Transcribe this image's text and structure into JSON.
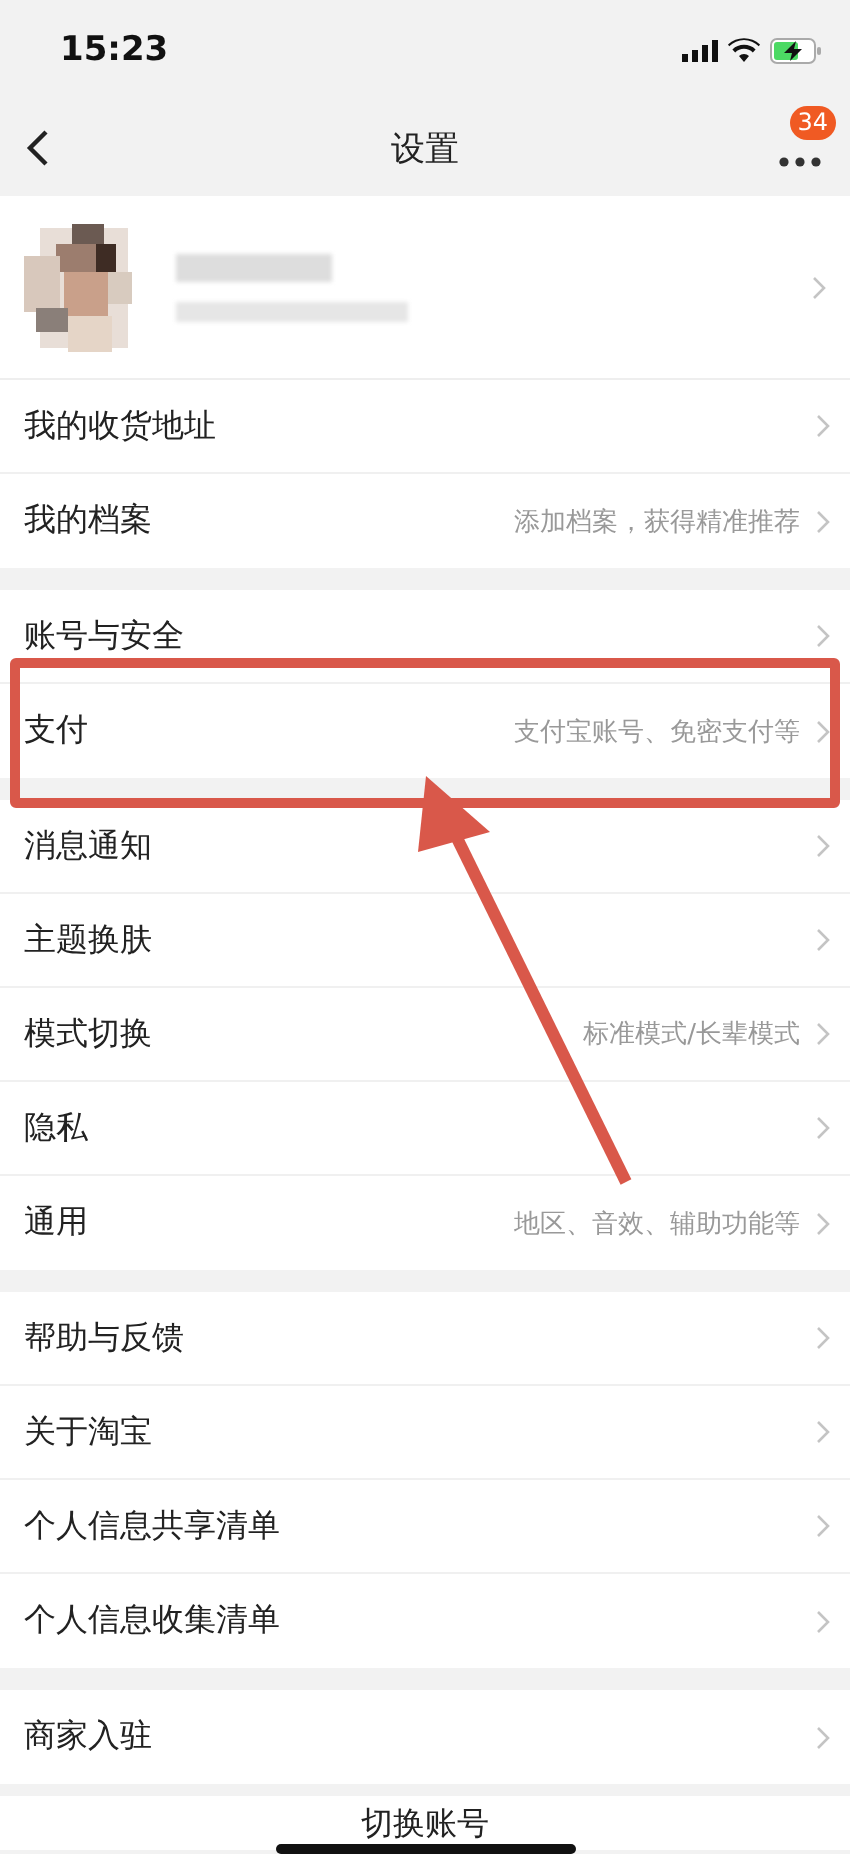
{
  "status_bar": {
    "time": "15:23"
  },
  "nav": {
    "title": "设置",
    "badge": "34"
  },
  "groups": [
    {
      "profile": true,
      "items": [
        {
          "label": "我的收货地址",
          "highlighted": false
        },
        {
          "label": "我的档案",
          "hint": "添加档案，获得精准推荐",
          "highlighted": false
        }
      ]
    },
    {
      "items": [
        {
          "label": "账号与安全",
          "highlighted": false
        },
        {
          "label": "支付",
          "hint": "支付宝账号、免密支付等",
          "highlighted": true
        }
      ]
    },
    {
      "items": [
        {
          "label": "消息通知",
          "highlighted": false
        },
        {
          "label": "主题换肤",
          "highlighted": false
        },
        {
          "label": "模式切换",
          "hint": "标准模式/长辈模式",
          "highlighted": false
        },
        {
          "label": "隐私",
          "highlighted": false
        },
        {
          "label": "通用",
          "hint": "地区、音效、辅助功能等",
          "highlighted": false
        }
      ]
    },
    {
      "items": [
        {
          "label": "帮助与反馈",
          "highlighted": false
        },
        {
          "label": "关于淘宝",
          "highlighted": false
        },
        {
          "label": "个人信息共享清单",
          "highlighted": false
        },
        {
          "label": "个人信息收集清单",
          "highlighted": false
        }
      ]
    },
    {
      "items": [
        {
          "label": "商家入驻",
          "highlighted": false
        }
      ]
    }
  ],
  "switch_account": {
    "label": "切换账号"
  }
}
